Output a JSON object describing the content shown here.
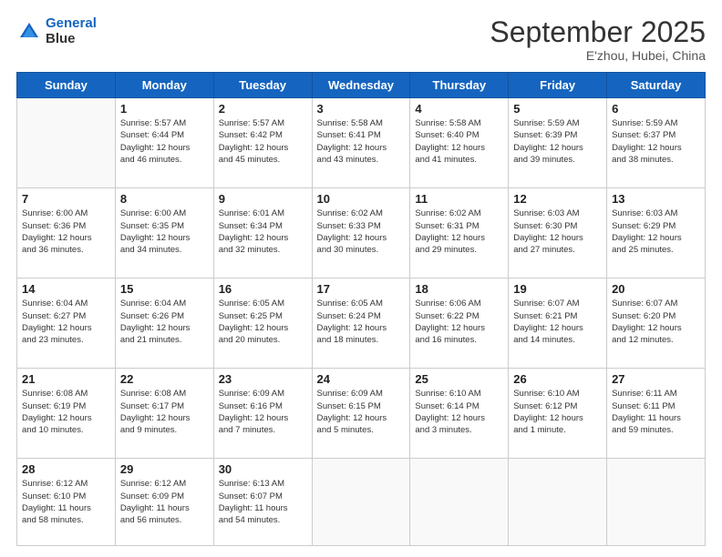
{
  "logo": {
    "line1": "General",
    "line2": "Blue"
  },
  "title": "September 2025",
  "subtitle": "E'zhou, Hubei, China",
  "days_header": [
    "Sunday",
    "Monday",
    "Tuesday",
    "Wednesday",
    "Thursday",
    "Friday",
    "Saturday"
  ],
  "weeks": [
    [
      {
        "num": "",
        "info": ""
      },
      {
        "num": "1",
        "info": "Sunrise: 5:57 AM\nSunset: 6:44 PM\nDaylight: 12 hours\nand 46 minutes."
      },
      {
        "num": "2",
        "info": "Sunrise: 5:57 AM\nSunset: 6:42 PM\nDaylight: 12 hours\nand 45 minutes."
      },
      {
        "num": "3",
        "info": "Sunrise: 5:58 AM\nSunset: 6:41 PM\nDaylight: 12 hours\nand 43 minutes."
      },
      {
        "num": "4",
        "info": "Sunrise: 5:58 AM\nSunset: 6:40 PM\nDaylight: 12 hours\nand 41 minutes."
      },
      {
        "num": "5",
        "info": "Sunrise: 5:59 AM\nSunset: 6:39 PM\nDaylight: 12 hours\nand 39 minutes."
      },
      {
        "num": "6",
        "info": "Sunrise: 5:59 AM\nSunset: 6:37 PM\nDaylight: 12 hours\nand 38 minutes."
      }
    ],
    [
      {
        "num": "7",
        "info": "Sunrise: 6:00 AM\nSunset: 6:36 PM\nDaylight: 12 hours\nand 36 minutes."
      },
      {
        "num": "8",
        "info": "Sunrise: 6:00 AM\nSunset: 6:35 PM\nDaylight: 12 hours\nand 34 minutes."
      },
      {
        "num": "9",
        "info": "Sunrise: 6:01 AM\nSunset: 6:34 PM\nDaylight: 12 hours\nand 32 minutes."
      },
      {
        "num": "10",
        "info": "Sunrise: 6:02 AM\nSunset: 6:33 PM\nDaylight: 12 hours\nand 30 minutes."
      },
      {
        "num": "11",
        "info": "Sunrise: 6:02 AM\nSunset: 6:31 PM\nDaylight: 12 hours\nand 29 minutes."
      },
      {
        "num": "12",
        "info": "Sunrise: 6:03 AM\nSunset: 6:30 PM\nDaylight: 12 hours\nand 27 minutes."
      },
      {
        "num": "13",
        "info": "Sunrise: 6:03 AM\nSunset: 6:29 PM\nDaylight: 12 hours\nand 25 minutes."
      }
    ],
    [
      {
        "num": "14",
        "info": "Sunrise: 6:04 AM\nSunset: 6:27 PM\nDaylight: 12 hours\nand 23 minutes."
      },
      {
        "num": "15",
        "info": "Sunrise: 6:04 AM\nSunset: 6:26 PM\nDaylight: 12 hours\nand 21 minutes."
      },
      {
        "num": "16",
        "info": "Sunrise: 6:05 AM\nSunset: 6:25 PM\nDaylight: 12 hours\nand 20 minutes."
      },
      {
        "num": "17",
        "info": "Sunrise: 6:05 AM\nSunset: 6:24 PM\nDaylight: 12 hours\nand 18 minutes."
      },
      {
        "num": "18",
        "info": "Sunrise: 6:06 AM\nSunset: 6:22 PM\nDaylight: 12 hours\nand 16 minutes."
      },
      {
        "num": "19",
        "info": "Sunrise: 6:07 AM\nSunset: 6:21 PM\nDaylight: 12 hours\nand 14 minutes."
      },
      {
        "num": "20",
        "info": "Sunrise: 6:07 AM\nSunset: 6:20 PM\nDaylight: 12 hours\nand 12 minutes."
      }
    ],
    [
      {
        "num": "21",
        "info": "Sunrise: 6:08 AM\nSunset: 6:19 PM\nDaylight: 12 hours\nand 10 minutes."
      },
      {
        "num": "22",
        "info": "Sunrise: 6:08 AM\nSunset: 6:17 PM\nDaylight: 12 hours\nand 9 minutes."
      },
      {
        "num": "23",
        "info": "Sunrise: 6:09 AM\nSunset: 6:16 PM\nDaylight: 12 hours\nand 7 minutes."
      },
      {
        "num": "24",
        "info": "Sunrise: 6:09 AM\nSunset: 6:15 PM\nDaylight: 12 hours\nand 5 minutes."
      },
      {
        "num": "25",
        "info": "Sunrise: 6:10 AM\nSunset: 6:14 PM\nDaylight: 12 hours\nand 3 minutes."
      },
      {
        "num": "26",
        "info": "Sunrise: 6:10 AM\nSunset: 6:12 PM\nDaylight: 12 hours\nand 1 minute."
      },
      {
        "num": "27",
        "info": "Sunrise: 6:11 AM\nSunset: 6:11 PM\nDaylight: 11 hours\nand 59 minutes."
      }
    ],
    [
      {
        "num": "28",
        "info": "Sunrise: 6:12 AM\nSunset: 6:10 PM\nDaylight: 11 hours\nand 58 minutes."
      },
      {
        "num": "29",
        "info": "Sunrise: 6:12 AM\nSunset: 6:09 PM\nDaylight: 11 hours\nand 56 minutes."
      },
      {
        "num": "30",
        "info": "Sunrise: 6:13 AM\nSunset: 6:07 PM\nDaylight: 11 hours\nand 54 minutes."
      },
      {
        "num": "",
        "info": ""
      },
      {
        "num": "",
        "info": ""
      },
      {
        "num": "",
        "info": ""
      },
      {
        "num": "",
        "info": ""
      }
    ]
  ]
}
